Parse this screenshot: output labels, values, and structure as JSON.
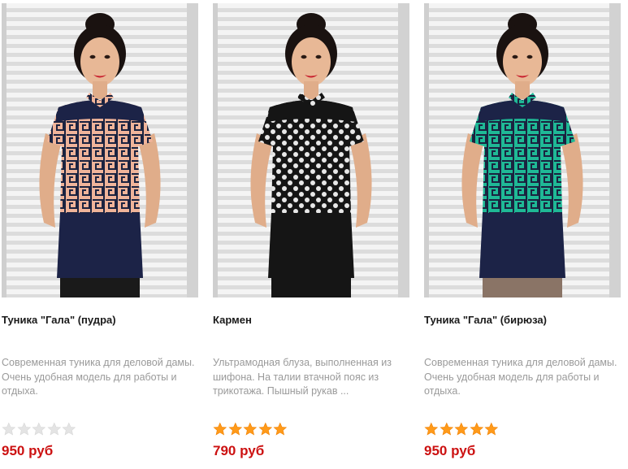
{
  "products": [
    {
      "title": "Туника \"Гала\" (пудра)",
      "description": "Современная туника для деловой дамы. Очень удобная модель для работы и отдыха.",
      "price": "950 руб",
      "rating": 0,
      "rating_max": 5,
      "image": {
        "shirt_color": "#f0b49a",
        "pattern": "geometric",
        "pattern_color": "#1b2340",
        "yoke_color": "#1c2347",
        "bottom_color": "#1c2347",
        "skirt_color": "#1a1a1a"
      }
    },
    {
      "title": "Кармен",
      "description": "Ультрамодная блуза, выполненная из шифона. На талии втачной пояс из трикотажа. Пышный рукав ...",
      "price": "790 руб",
      "rating": 5,
      "rating_max": 5,
      "image": {
        "shirt_color": "#151515",
        "pattern": "polka-dot",
        "pattern_color": "#e8e8e8",
        "yoke_color": "#151515",
        "bottom_color": "#151515",
        "skirt_color": "#151515"
      }
    },
    {
      "title": "Туника \"Гала\" (бирюза)",
      "description": "Современная туника для деловой дамы. Очень удобная модель для работы и отдыха.",
      "price": "950 руб",
      "rating": 5,
      "rating_max": 5,
      "image": {
        "shirt_color": "#1fb996",
        "pattern": "geometric",
        "pattern_color": "#1b2340",
        "yoke_color": "#1c2347",
        "bottom_color": "#1c2347",
        "skirt_color": "#8a7466"
      }
    }
  ],
  "colors": {
    "star_filled": "#ff9a1a",
    "star_empty": "#e4e4e4",
    "price": "#cc1111",
    "description": "#9a9a9a"
  }
}
